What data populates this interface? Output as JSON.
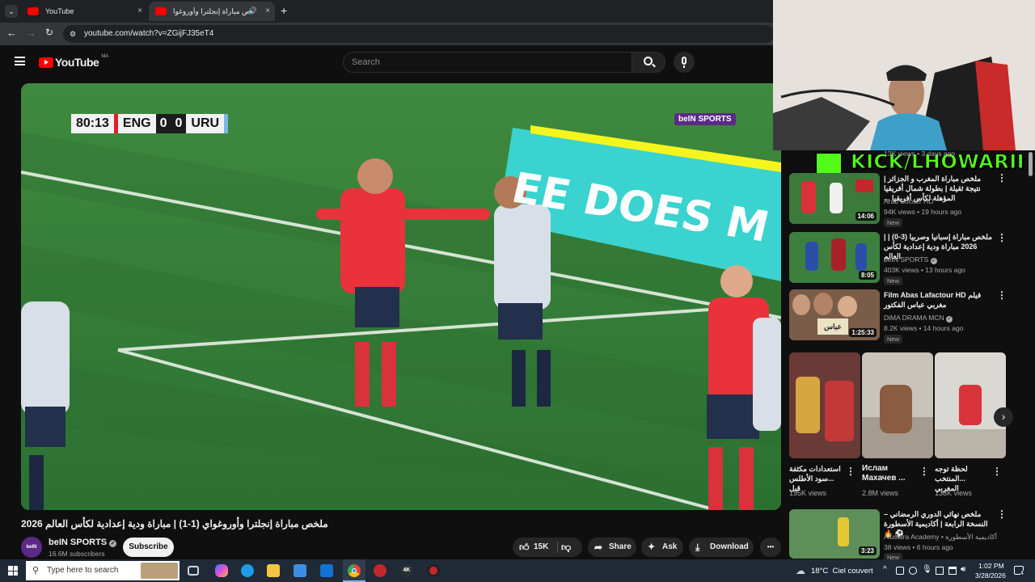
{
  "browser": {
    "tabs": [
      {
        "label": "YouTube",
        "close": "×"
      },
      {
        "label": "ملخص مباراة إنجلترا وأوروغوا",
        "close": "×"
      }
    ],
    "new_tab": "+",
    "url": "youtube.com/watch?v=ZGijFJ35eT4"
  },
  "youtube": {
    "logo_text": "YouTube",
    "region": "MA",
    "search_placeholder": "Search"
  },
  "overlay": {
    "score": {
      "time": "80:13",
      "home": "ENG",
      "home_score": "0",
      "away_score": "0",
      "away": "URU"
    },
    "broadcaster": "beIN SPORTS",
    "ad_board": "EE DOES M",
    "kick_label": "KICK/LHOWARII"
  },
  "video": {
    "title": "ملخص مباراة إنجلترا وأوروغواي (1-1) | مباراة ودية إعدادية لكأس العالم 2026",
    "channel": "beIN SPORTS",
    "subscribers": "16.6M subscribers",
    "subscribe": "Subscribe",
    "likes": "15K",
    "share": "Share",
    "ask": "Ask",
    "download": "Download",
    "more": "•••"
  },
  "sidebar": {
    "partial_meta": "13K views • 3 days ago",
    "items": [
      {
        "title": "ملخص مباراة المغرب و الجزائر | نتيجة ثقيلة | بطولة شمال أفريقيا المؤهلة لكأس أفريقيا ...",
        "channel": "Arab Soccer HD",
        "meta": "94K views • 19 hours ago",
        "badge": "New",
        "duration": "14:06"
      },
      {
        "title": "ملخص مباراة إسبانيا وصربيا (3-0) | | 2026 مباراة ودية إعدادية لكأس العالم",
        "channel": "beIN SPORTS",
        "meta": "403K views • 13 hours ago",
        "badge": "New",
        "duration": "8:05"
      },
      {
        "title": "Film Abas Lafactour HD فيلم مغربي عباس الفكتور",
        "channel": "DiMA DRAMA MCN",
        "meta": "8.2K views • 14 hours ago",
        "badge": "New",
        "duration": "1:25:33"
      }
    ],
    "shorts": [
      {
        "title": "استعدادات مكثفة ...سود الأطلس قبل",
        "views": "195K views"
      },
      {
        "title": "Ислам Махачев ...",
        "views": "2.8M views"
      },
      {
        "title": "لحظة توجه ...المنتخب المغربي",
        "views": "138K views"
      }
    ],
    "shorts_next": "›",
    "last_item": {
      "title": "ملخص نهائي الدوري الرمضاني – النسخة الرابعة | أكاديمية الأسطورة ⚽ 🔥",
      "channel": "Alustura Academy • أكاديمية الأسطورة",
      "meta": "38 views • 6 hours ago",
      "badge": "New",
      "duration": "3:23"
    }
  },
  "taskbar": {
    "search_placeholder": "Type here to search",
    "weather": "18°C  Ciel couvert",
    "time": "1:02 PM",
    "date": "3/28/2026",
    "notif_count": "4"
  }
}
